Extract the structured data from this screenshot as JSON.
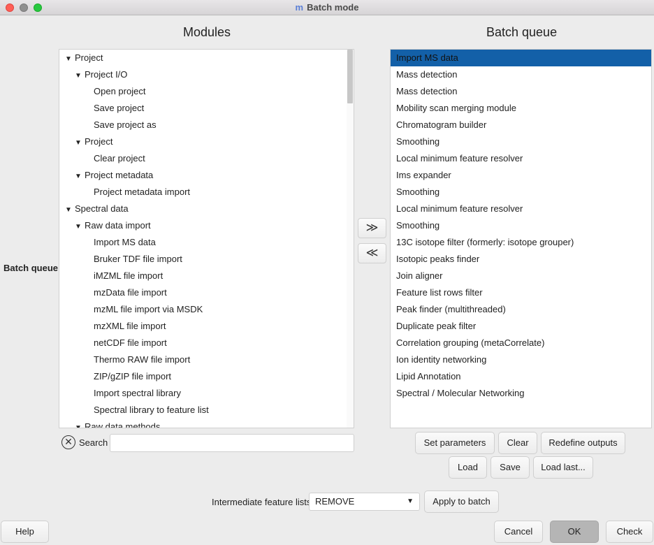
{
  "window": {
    "title": "Batch mode",
    "app_icon": "m"
  },
  "modules": {
    "title": "Modules",
    "tree": [
      {
        "label": "Project",
        "level": 0,
        "expanded": true
      },
      {
        "label": "Project I/O",
        "level": 1,
        "expanded": true
      },
      {
        "label": "Open project",
        "level": 2
      },
      {
        "label": "Save project",
        "level": 2
      },
      {
        "label": "Save project as",
        "level": 2
      },
      {
        "label": "Project",
        "level": 1,
        "expanded": true
      },
      {
        "label": "Clear project",
        "level": 2
      },
      {
        "label": "Project metadata",
        "level": 1,
        "expanded": true
      },
      {
        "label": "Project metadata import",
        "level": 2
      },
      {
        "label": "Spectral data",
        "level": 0,
        "expanded": true
      },
      {
        "label": "Raw data import",
        "level": 1,
        "expanded": true
      },
      {
        "label": "Import MS data",
        "level": 2
      },
      {
        "label": "Bruker TDF file import",
        "level": 2
      },
      {
        "label": "iMZML file import",
        "level": 2
      },
      {
        "label": "mzData file import",
        "level": 2
      },
      {
        "label": "mzML file import via MSDK",
        "level": 2
      },
      {
        "label": "mzXML file import",
        "level": 2
      },
      {
        "label": "netCDF file import",
        "level": 2
      },
      {
        "label": "Thermo RAW file import",
        "level": 2
      },
      {
        "label": "ZIP/gZIP file import",
        "level": 2
      },
      {
        "label": "Import spectral library",
        "level": 2
      },
      {
        "label": "Spectral library to feature list",
        "level": 2
      },
      {
        "label": "Raw data methods",
        "level": 1,
        "expanded": true
      }
    ],
    "search_label": "Search",
    "search_value": ""
  },
  "side_label": "Batch queue",
  "queue": {
    "title": "Batch queue",
    "selected_index": 0,
    "items": [
      "Import MS data",
      "Mass detection",
      "Mass detection",
      "Mobility scan merging module",
      "Chromatogram builder",
      "Smoothing",
      "Local minimum feature resolver",
      "Ims expander",
      "Smoothing",
      "Local minimum feature resolver",
      "Smoothing",
      "13C isotope filter (formerly: isotope grouper)",
      "Isotopic peaks finder",
      "Join aligner",
      "Feature list rows filter",
      "Peak finder (multithreaded)",
      "Duplicate peak filter",
      "Correlation grouping (metaCorrelate)",
      "Ion identity networking",
      "Lipid Annotation",
      "Spectral / Molecular Networking"
    ]
  },
  "transfer": {
    "add_symbol": "≫",
    "remove_symbol": "≪"
  },
  "queue_buttons": {
    "set_parameters": "Set parameters",
    "clear": "Clear",
    "redefine_outputs": "Redefine outputs",
    "load": "Load",
    "save": "Save",
    "load_last": "Load last..."
  },
  "intermediate": {
    "label": "Intermediate feature lists",
    "value": "REMOVE",
    "apply": "Apply to batch"
  },
  "footer": {
    "help": "Help",
    "cancel": "Cancel",
    "ok": "OK",
    "check": "Check"
  },
  "colors": {
    "selection": "#1360a8",
    "ok_button": "#b5b5b5"
  }
}
